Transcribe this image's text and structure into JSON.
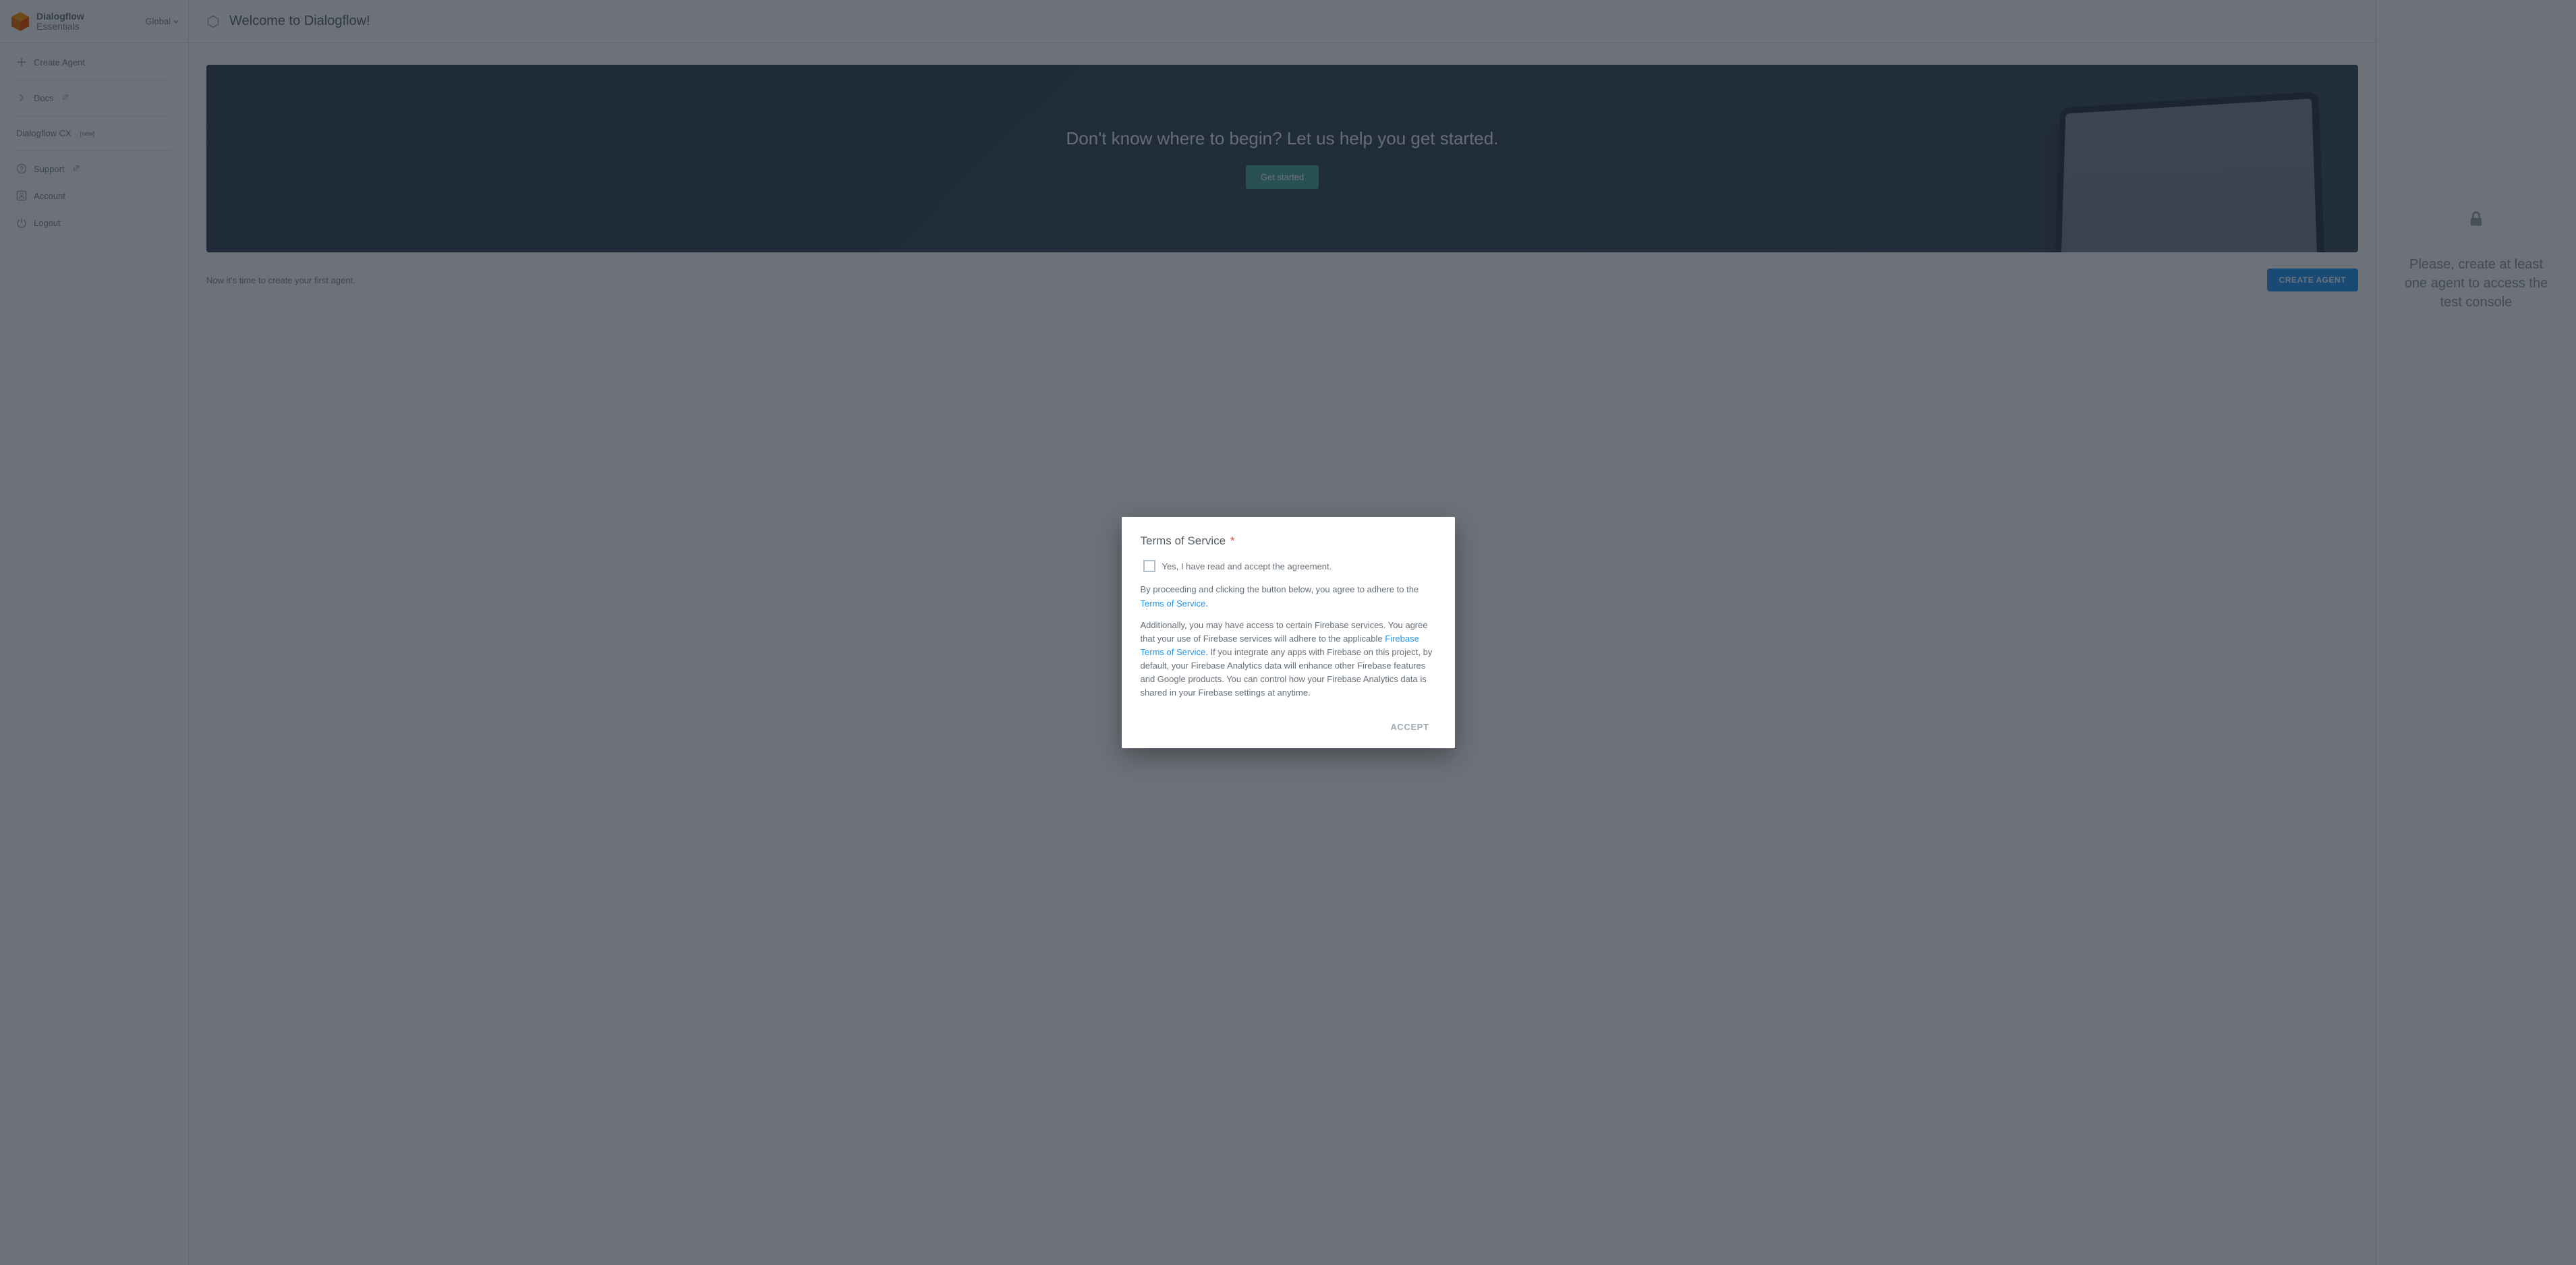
{
  "brand": {
    "line1": "Dialogflow",
    "line2": "Essentials"
  },
  "region": {
    "label": "Global"
  },
  "sidebar": {
    "create_agent": "Create Agent",
    "docs": "Docs",
    "cx": {
      "label": "Dialogflow CX",
      "badge": "[new]"
    },
    "support": "Support",
    "account": "Account",
    "logout": "Logout"
  },
  "header": {
    "title": "Welcome to Dialogflow!"
  },
  "hero": {
    "title": "Don't know where to begin? Let us help you get started.",
    "button": "Get started"
  },
  "cta": {
    "text": "Now it's time to create your first agent.",
    "button": "CREATE AGENT"
  },
  "right_panel": {
    "message": "Please, create at least one agent to access the test console"
  },
  "dialog": {
    "title": "Terms of Service",
    "required_mark": "*",
    "checkbox_label": "Yes, I have read and accept the agreement.",
    "para1_before": "By proceeding and clicking the button below, you agree to adhere to the ",
    "para1_link": "Terms of Service",
    "para1_after": ".",
    "para2_before": "Additionally, you may have access to certain Firebase services. You agree that your use of Firebase services will adhere to the applicable ",
    "para2_link": "Firebase Terms of Service",
    "para2_after": ". If you integrate any apps with Firebase on this project, by default, your Firebase Analytics data will enhance other Firebase features and Google products. You can control how your Firebase Analytics data is shared in your Firebase settings at anytime.",
    "accept": "ACCEPT"
  }
}
